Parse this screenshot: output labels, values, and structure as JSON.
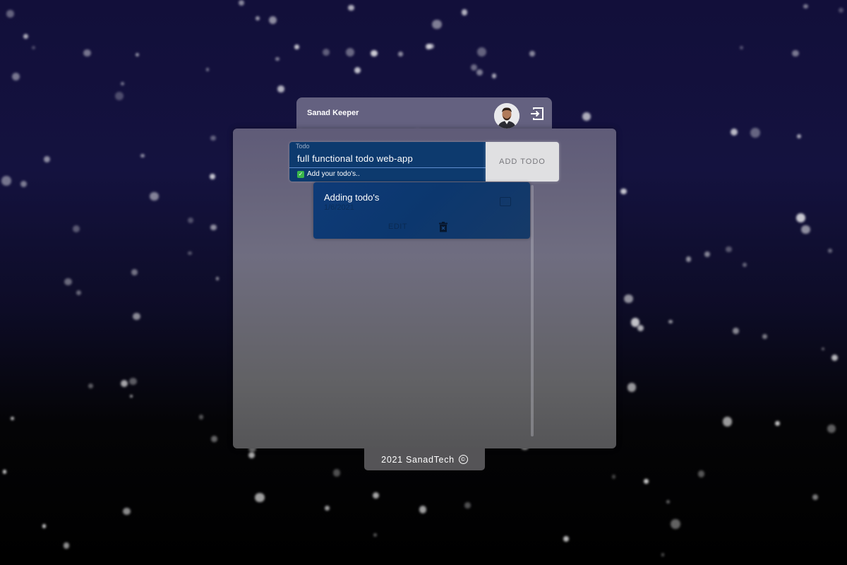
{
  "header": {
    "app_title": "Sanad Keeper",
    "avatar_icon": "user-avatar",
    "logout_icon": "logout-icon"
  },
  "form": {
    "label": "Todo",
    "value": "full functional todo web-app",
    "helper": "Add your todo's..",
    "add_button": "ADD TODO"
  },
  "todos": [
    {
      "text": "Adding todo's",
      "date": "1/6/2021",
      "edit_label": "EDIT",
      "completed": false
    }
  ],
  "footer": {
    "text": "2021 SanadTech",
    "copyright_symbol": "©"
  },
  "colors": {
    "accent_blue": "#0d3a6e",
    "background": "#120f3a"
  }
}
